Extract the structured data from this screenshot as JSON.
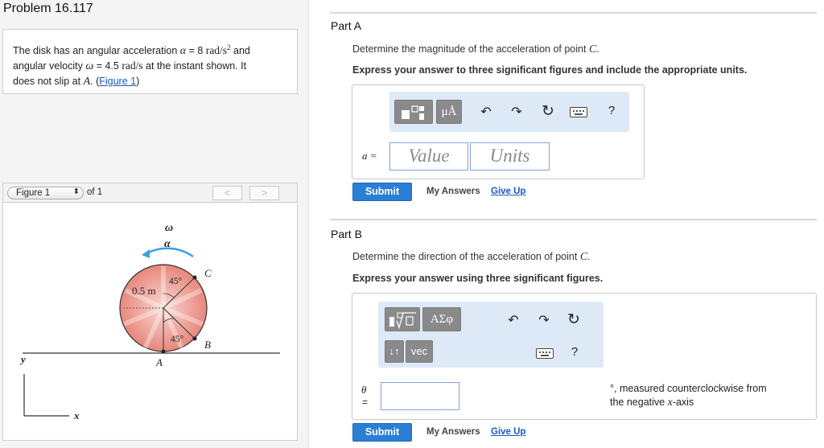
{
  "problem": {
    "title": "Problem 16.117",
    "text_1": "The disk has an angular acceleration ",
    "alpha_sym": "α",
    "text_eq1": " = 8 ",
    "unit_rad_s2": "rad/s",
    "sup2": "2",
    "text_and": " and",
    "text_2": "angular velocity ",
    "omega_sym": "ω",
    "text_eq2": " = 4.5 ",
    "unit_rad_s": "rad/s",
    "text_3": " at the instant shown. It",
    "text_4": "does not slip at ",
    "point_A": "A",
    "text_5": ". (",
    "figure_link": "Figure 1",
    "text_6": ")"
  },
  "figure_nav": {
    "select_value": "Figure 1",
    "select_arrows": "⬍",
    "of_label": "of 1",
    "prev": "<",
    "next": ">"
  },
  "figure": {
    "omega": "ω",
    "alpha": "α",
    "radius_label": "0.5 m",
    "angle_top": "45°",
    "angle_bottom": "45°",
    "point_A": "A",
    "point_B": "B",
    "point_C": "C",
    "axis_y": "y",
    "axis_x": "x",
    "colors": {
      "disk": "#e8877c",
      "disk_light": "#f8d8d2",
      "arrow": "#3aa0e0"
    }
  },
  "partA": {
    "title": "Part A",
    "question_1": "Determine the magnitude of the acceleration of point ",
    "point": "C",
    "question_2": ".",
    "instruction": "Express your answer to three significant figures and include the appropriate units.",
    "toolbar": {
      "template_icon": "template-icon",
      "units_label": "μÅ",
      "undo": "↶",
      "redo": "↷",
      "reset": "↻",
      "keyboard": "keyboard-icon",
      "help": "?"
    },
    "var_label": "a =",
    "value_placeholder": "Value",
    "units_placeholder": "Units",
    "submit": "Submit",
    "my_answers": "My Answers",
    "give_up": "Give Up"
  },
  "partB": {
    "title": "Part B",
    "question_1": "Determine the direction of the acceleration of point ",
    "point": "C",
    "question_2": ".",
    "instruction": "Express your answer using three significant figures.",
    "toolbar": {
      "greek_label": "ΑΣφ",
      "arrows_label": "↓↑",
      "vec_label": "vec",
      "undo": "↶",
      "redo": "↷",
      "reset": "↻",
      "keyboard": "keyboard-icon",
      "help": "?"
    },
    "var_label": "θ",
    "var_eq": "=",
    "suffix_1": "°, measured counterclockwise from",
    "suffix_2_pre": "the negative ",
    "suffix_axis": "x",
    "suffix_2_post": "-axis",
    "submit": "Submit",
    "my_answers": "My Answers",
    "give_up": "Give Up"
  }
}
